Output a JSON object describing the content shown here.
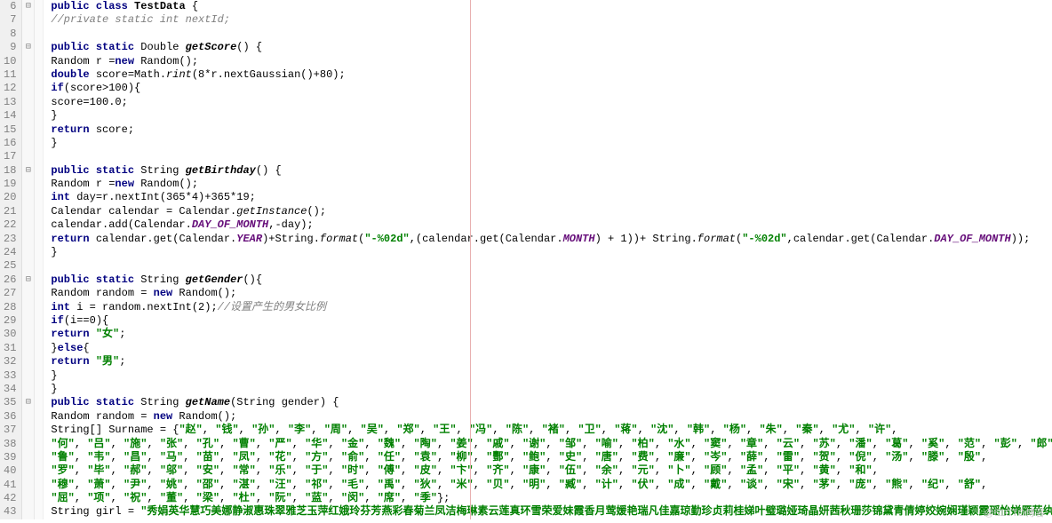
{
  "lines": [
    {
      "num": 6,
      "fold": "⊟",
      "html": "<span class='kw'>public</span> <span class='kw'>class</span> <span class='cls'>TestData</span> {"
    },
    {
      "num": 7,
      "fold": "",
      "html": "        <span class='cmt'>//private static int nextId;</span>"
    },
    {
      "num": 8,
      "fold": "",
      "html": ""
    },
    {
      "num": 9,
      "fold": "⊟",
      "html": "        <span class='kw'>public</span> <span class='kw'>static</span> Double <span class='mth'>getScore</span>() {"
    },
    {
      "num": 10,
      "fold": "",
      "html": "                Random r =<span class='kw'>new</span> Random();"
    },
    {
      "num": 11,
      "fold": "",
      "html": "                <span class='kw'>double</span> score=Math.<span class='staticm'>rint</span>(8*r.nextGaussian()+80);"
    },
    {
      "num": 12,
      "fold": "",
      "html": "                <span class='kw'>if</span>(score>100){"
    },
    {
      "num": 13,
      "fold": "",
      "html": "                    score=100.0;"
    },
    {
      "num": 14,
      "fold": "",
      "html": "                }"
    },
    {
      "num": 15,
      "fold": "",
      "html": "                <span class='kw'>return</span> score;"
    },
    {
      "num": 16,
      "fold": "",
      "html": "        }"
    },
    {
      "num": 17,
      "fold": "",
      "html": ""
    },
    {
      "num": 18,
      "fold": "⊟",
      "html": "        <span class='kw'>public</span> <span class='kw'>static</span> String <span class='mth'>getBirthday</span>() {"
    },
    {
      "num": 19,
      "fold": "",
      "html": "                Random r =<span class='kw'>new</span> Random();"
    },
    {
      "num": 20,
      "fold": "",
      "html": "                <span class='kw'>int</span> day=r.nextInt(365*4)+365*19;"
    },
    {
      "num": 21,
      "fold": "",
      "html": "                Calendar calendar = Calendar.<span class='staticm'>getInstance</span>();"
    },
    {
      "num": 22,
      "fold": "",
      "html": "                calendar.add(Calendar.<span class='const'>DAY_OF_MONTH</span>,-day);"
    },
    {
      "num": 23,
      "fold": "",
      "html": "                <span class='kw'>return</span> calendar.get(Calendar.<span class='const'>YEAR</span>)+String.<span class='staticm'>format</span>(<span class='str'>\"-%02d\"</span>,(calendar.get(Calendar.<span class='const'>MONTH</span>) + 1))+ String.<span class='staticm'>format</span>(<span class='str'>\"-%02d\"</span>,calendar.get(Calendar.<span class='const'>DAY_OF_MONTH</span>));"
    },
    {
      "num": 24,
      "fold": "",
      "html": "        }"
    },
    {
      "num": 25,
      "fold": "",
      "html": ""
    },
    {
      "num": 26,
      "fold": "⊟",
      "html": "        <span class='kw'>public</span> <span class='kw'>static</span> String <span class='mth'>getGender</span>(){"
    },
    {
      "num": 27,
      "fold": "",
      "html": "            Random random = <span class='kw'>new</span> Random();"
    },
    {
      "num": 28,
      "fold": "",
      "html": "            <span class='kw'>int</span> i = random.nextInt(2);<span class='cmt'>//设置产生的男女比例</span>"
    },
    {
      "num": 29,
      "fold": "",
      "html": "            <span class='kw'>if</span>(i==0){"
    },
    {
      "num": 30,
      "fold": "",
      "html": "                <span class='kw'>return</span> <span class='str'>\"女\"</span>;"
    },
    {
      "num": 31,
      "fold": "",
      "html": "            }<span class='kw'>else</span>{"
    },
    {
      "num": 32,
      "fold": "",
      "html": "                <span class='kw'>return</span> <span class='str'>\"男\"</span>;"
    },
    {
      "num": 33,
      "fold": "",
      "html": "            }"
    },
    {
      "num": 34,
      "fold": "",
      "html": "        }"
    },
    {
      "num": 35,
      "fold": "⊟",
      "html": "        <span class='kw'>public</span> <span class='kw'>static</span> String <span class='mth'>getName</span>(String gender) {"
    },
    {
      "num": 36,
      "fold": "",
      "html": "        Random random = <span class='kw'>new</span> Random();"
    },
    {
      "num": 37,
      "fold": "",
      "html": "        String[] Surname = {<span class='str'>\"赵\"</span>, <span class='str'>\"钱\"</span>, <span class='str'>\"孙\"</span>, <span class='str'>\"李\"</span>, <span class='str'>\"周\"</span>, <span class='str'>\"吴\"</span>, <span class='str'>\"郑\"</span>, <span class='str'>\"王\"</span>, <span class='str'>\"冯\"</span>, <span class='str'>\"陈\"</span>, <span class='str'>\"褚\"</span>, <span class='str'>\"卫\"</span>, <span class='str'>\"蒋\"</span>, <span class='str'>\"沈\"</span>, <span class='str'>\"韩\"</span>, <span class='str'>\"杨\"</span>, <span class='str'>\"朱\"</span>, <span class='str'>\"秦\"</span>, <span class='str'>\"尤\"</span>, <span class='str'>\"许\"</span>,"
    },
    {
      "num": 38,
      "fold": "",
      "html": "                <span class='str'>\"何\"</span>, <span class='str'>\"吕\"</span>, <span class='str'>\"施\"</span>, <span class='str'>\"张\"</span>, <span class='str'>\"孔\"</span>, <span class='str'>\"曹\"</span>, <span class='str'>\"严\"</span>, <span class='str'>\"华\"</span>, <span class='str'>\"金\"</span>, <span class='str'>\"魏\"</span>, <span class='str'>\"陶\"</span>, <span class='str'>\"姜\"</span>, <span class='str'>\"戚\"</span>, <span class='str'>\"谢\"</span>, <span class='str'>\"邹\"</span>, <span class='str'>\"喻\"</span>, <span class='str'>\"柏\"</span>, <span class='str'>\"水\"</span>, <span class='str'>\"窦\"</span>, <span class='str'>\"章\"</span>, <span class='str'>\"云\"</span>, <span class='str'>\"苏\"</span>, <span class='str'>\"潘\"</span>, <span class='str'>\"葛\"</span>, <span class='str'>\"奚\"</span>, <span class='str'>\"范\"</span>, <span class='str'>\"彭\"</span>, <span class='str'>\"郎\"</span>,"
    },
    {
      "num": 39,
      "fold": "",
      "html": "                <span class='str'>\"鲁\"</span>, <span class='str'>\"韦\"</span>, <span class='str'>\"昌\"</span>, <span class='str'>\"马\"</span>, <span class='str'>\"苗\"</span>, <span class='str'>\"凤\"</span>, <span class='str'>\"花\"</span>, <span class='str'>\"方\"</span>, <span class='str'>\"俞\"</span>, <span class='str'>\"任\"</span>, <span class='str'>\"袁\"</span>, <span class='str'>\"柳\"</span>, <span class='str'>\"酆\"</span>, <span class='str'>\"鲍\"</span>, <span class='str'>\"史\"</span>, <span class='str'>\"唐\"</span>, <span class='str'>\"费\"</span>, <span class='str'>\"廉\"</span>, <span class='str'>\"岑\"</span>, <span class='str'>\"薛\"</span>, <span class='str'>\"雷\"</span>, <span class='str'>\"贺\"</span>, <span class='str'>\"倪\"</span>, <span class='str'>\"汤\"</span>, <span class='str'>\"滕\"</span>, <span class='str'>\"殷\"</span>,"
    },
    {
      "num": 40,
      "fold": "",
      "html": "                <span class='str'>\"罗\"</span>, <span class='str'>\"毕\"</span>, <span class='str'>\"郝\"</span>, <span class='str'>\"邬\"</span>, <span class='str'>\"安\"</span>, <span class='str'>\"常\"</span>, <span class='str'>\"乐\"</span>, <span class='str'>\"于\"</span>, <span class='str'>\"时\"</span>, <span class='str'>\"傅\"</span>, <span class='str'>\"皮\"</span>, <span class='str'>\"卞\"</span>, <span class='str'>\"齐\"</span>, <span class='str'>\"康\"</span>, <span class='str'>\"伍\"</span>, <span class='str'>\"余\"</span>, <span class='str'>\"元\"</span>, <span class='str'>\"卜\"</span>, <span class='str'>\"顾\"</span>, <span class='str'>\"孟\"</span>, <span class='str'>\"平\"</span>, <span class='str'>\"黄\"</span>, <span class='str'>\"和\"</span>,"
    },
    {
      "num": 41,
      "fold": "",
      "html": "                <span class='str'>\"穆\"</span>, <span class='str'>\"萧\"</span>, <span class='str'>\"尹\"</span>, <span class='str'>\"姚\"</span>, <span class='str'>\"邵\"</span>, <span class='str'>\"湛\"</span>, <span class='str'>\"汪\"</span>, <span class='str'>\"祁\"</span>, <span class='str'>\"毛\"</span>, <span class='str'>\"禹\"</span>, <span class='str'>\"狄\"</span>, <span class='str'>\"米\"</span>, <span class='str'>\"贝\"</span>, <span class='str'>\"明\"</span>, <span class='str'>\"臧\"</span>, <span class='str'>\"计\"</span>, <span class='str'>\"伏\"</span>, <span class='str'>\"成\"</span>, <span class='str'>\"戴\"</span>, <span class='str'>\"谈\"</span>, <span class='str'>\"宋\"</span>, <span class='str'>\"茅\"</span>, <span class='str'>\"庞\"</span>, <span class='str'>\"熊\"</span>, <span class='str'>\"纪\"</span>, <span class='str'>\"舒\"</span>,"
    },
    {
      "num": 42,
      "fold": "",
      "html": "                <span class='str'>\"屈\"</span>, <span class='str'>\"项\"</span>, <span class='str'>\"祝\"</span>, <span class='str'>\"董\"</span>, <span class='str'>\"梁\"</span>, <span class='str'>\"杜\"</span>, <span class='str'>\"阮\"</span>, <span class='str'>\"蓝\"</span>, <span class='str'>\"闵\"</span>, <span class='str'>\"席\"</span>, <span class='str'>\"季\"</span>};"
    },
    {
      "num": 43,
      "fold": "",
      "html": "        String girl = <span class='str'>\"秀娟英华慧巧美娜静淑惠珠翠雅芝玉萍红娥玲芬芳燕彩春菊兰凤洁梅琳素云莲真环雪荣爱妹霞香月莺媛艳瑞凡佳嘉琼勤珍贞莉桂娣叶璧璐娅琦晶妍茜秋珊莎锦黛青倩婷姣婉娴瑾颖露瑶怡婵雁蓓纨仪荷丹蓉眉君琴蕊薇菁梦岚苑婕馨珊\"</span>"
    }
  ],
  "watermark": "@51CTO博客"
}
